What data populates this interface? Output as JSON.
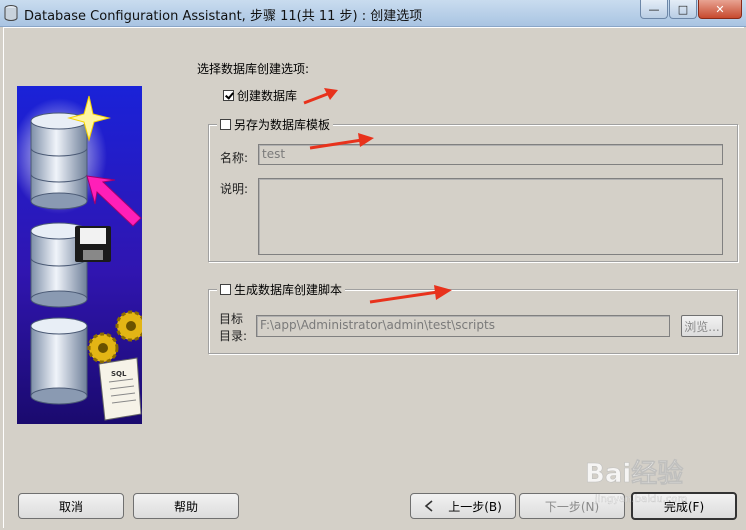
{
  "window": {
    "title": "Database Configuration Assistant, 步骤 11(共 11 步) : 创建选项",
    "minimize_glyph": "—",
    "maximize_glyph": "□",
    "close_glyph": "✕"
  },
  "main": {
    "prompt": "选择数据库创建选项:",
    "create_database": {
      "label": "创建数据库",
      "checked": true
    },
    "save_template": {
      "label": "另存为数据库模板",
      "checked": false,
      "name_label": "名称:",
      "name_value": "test",
      "desc_label": "说明:",
      "desc_value": ""
    },
    "generate_scripts": {
      "label": "生成数据库创建脚本",
      "checked": false,
      "dest_label_line1": "目标",
      "dest_label_line2": "目录:",
      "dest_value": "F:\\app\\Administrator\\admin\\test\\scripts",
      "browse_label": "浏览..."
    }
  },
  "footer": {
    "cancel_label": "取消",
    "help_label": "帮助",
    "back_label": "上一步(B)",
    "next_label": "下一步(N)",
    "finish_label": "完成(F)"
  },
  "watermark": {
    "text": "Bai经验",
    "url": "jingyan.baidu.com"
  },
  "colors": {
    "annotation_arrow": "#e8321c",
    "titlebar": "#b9cfe6",
    "dialog_bg": "#d4d0c8"
  }
}
